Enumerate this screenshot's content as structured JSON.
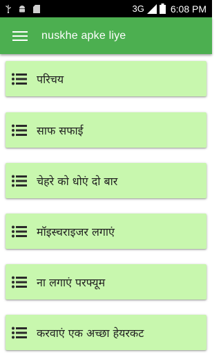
{
  "status_bar": {
    "network_type": "3G",
    "time": "6:08",
    "time_suffix": "PM",
    "icons": [
      "usb-icon",
      "android-icon",
      "sd-card-icon",
      "signal-icon",
      "battery-icon"
    ]
  },
  "app_bar": {
    "title": "nuskhe apke liye",
    "background_color": "#4caf50",
    "menu_icon": "hamburger-menu-icon"
  },
  "list": {
    "item_background_color": "#c8f7ae",
    "item_icon": "list-icon",
    "items": [
      {
        "label": "परिचय"
      },
      {
        "label": "साफ सफाई"
      },
      {
        "label": "चेहरे को धोएं दो बार"
      },
      {
        "label": "मॉइस्चराइजर लगाएं"
      },
      {
        "label": "ना लगाएं परफ्यूम"
      },
      {
        "label": "करवाएं एक अच्छा हेयरकट"
      }
    ]
  }
}
